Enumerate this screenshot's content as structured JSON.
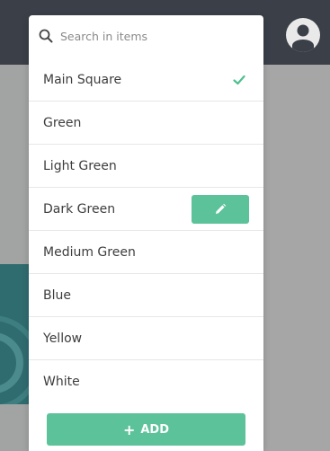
{
  "colors": {
    "topbar": "#3a3f48",
    "accent": "#5cc29a",
    "check": "#4fbf8f",
    "overlay": "#a9a9a9"
  },
  "header": {
    "avatar_icon": "user-avatar-icon"
  },
  "dropdown": {
    "search": {
      "placeholder": "Search in items",
      "icon": "search-icon"
    },
    "items": [
      {
        "label": "Main Square",
        "selected": true
      },
      {
        "label": "Green"
      },
      {
        "label": "Light Green"
      },
      {
        "label": "Dark Green",
        "edit_icon": "pencil-icon"
      },
      {
        "label": "Medium Green"
      },
      {
        "label": "Blue"
      },
      {
        "label": "Yellow"
      },
      {
        "label": "White"
      }
    ],
    "add_button": {
      "icon": "+",
      "label": "ADD"
    }
  }
}
